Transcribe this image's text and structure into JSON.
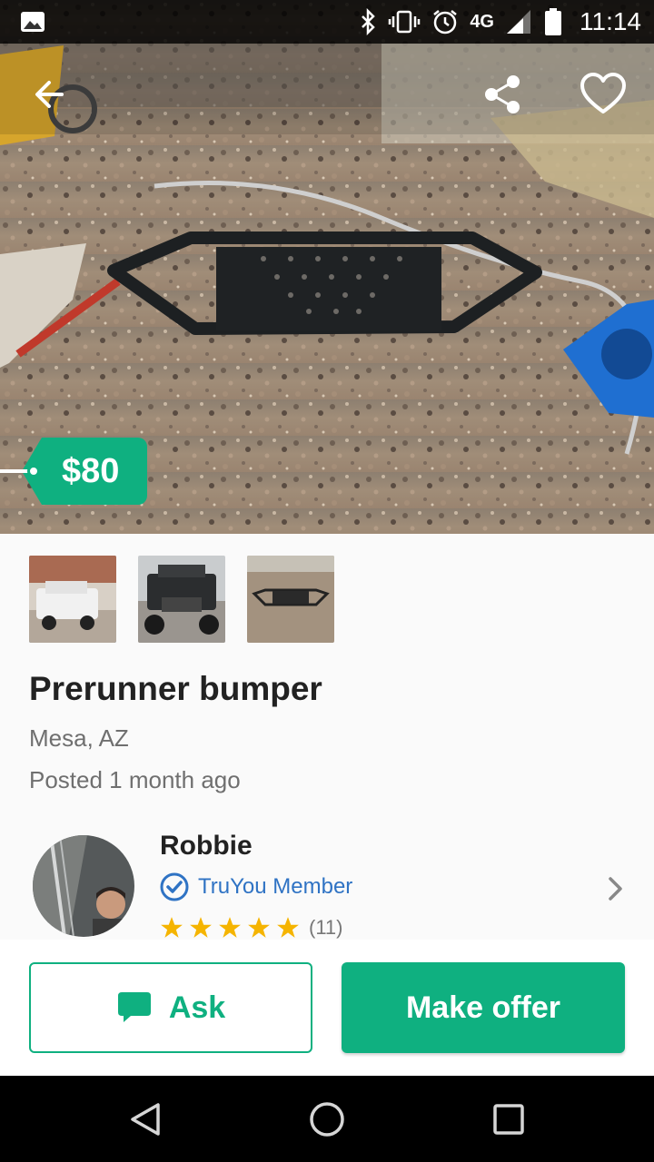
{
  "status_bar": {
    "time": "11:14",
    "network": "4G",
    "icons": [
      "gallery-icon",
      "bluetooth-icon",
      "vibrate-icon",
      "alarm-icon",
      "lte-icon",
      "signal-icon",
      "battery-icon"
    ]
  },
  "toolbar": {
    "icons": [
      "back-arrow-icon",
      "share-icon",
      "heart-icon"
    ]
  },
  "listing": {
    "price": "$80",
    "title": "Prerunner bumper",
    "location": "Mesa, AZ",
    "posted": "Posted 1 month ago",
    "thumbnail_count": 3
  },
  "seller": {
    "name": "Robbie",
    "badge": "TruYou Member",
    "rating_stars": 5,
    "review_count": "(11)"
  },
  "actions": {
    "ask_label": "Ask",
    "offer_label": "Make offer"
  },
  "colors": {
    "brand_green": "#0fb080",
    "truyou_blue": "#2f73c4",
    "star_yellow": "#f5b400"
  },
  "nav_bar": {
    "icons": [
      "back-triangle-icon",
      "home-circle-icon",
      "recents-square-icon"
    ]
  }
}
